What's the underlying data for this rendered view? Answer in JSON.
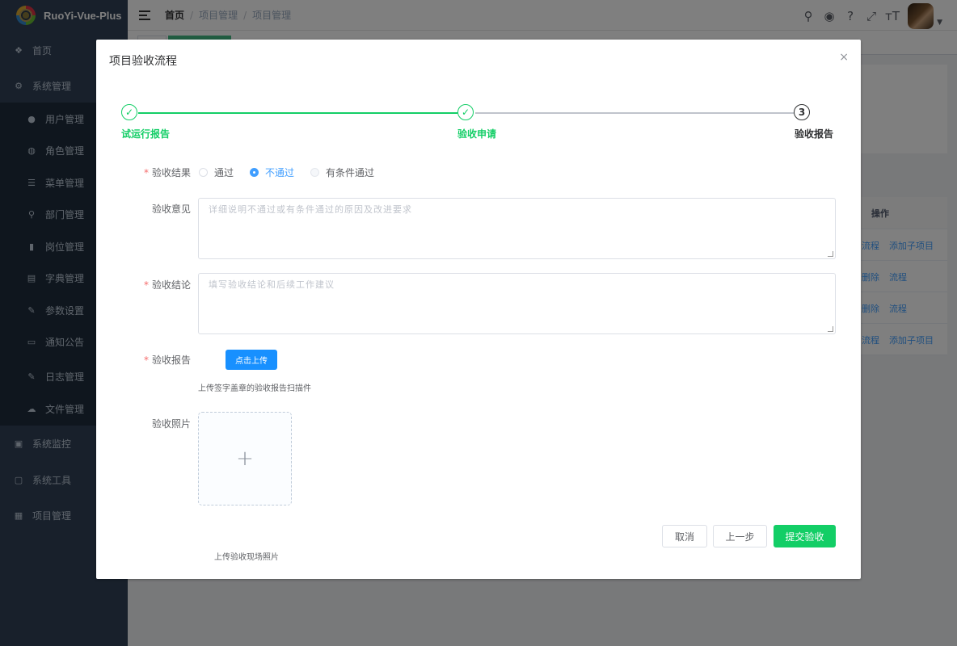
{
  "app": {
    "name": "RuoYi-Vue-Plus"
  },
  "sidebar": {
    "top_items": [
      {
        "label": "首页",
        "icon": "dashboard-icon"
      },
      {
        "label": "系统管理",
        "icon": "gear-icon"
      }
    ],
    "sub_items": [
      {
        "label": "用户管理",
        "icon": "user-icon"
      },
      {
        "label": "角色管理",
        "icon": "peoples-icon"
      },
      {
        "label": "菜单管理",
        "icon": "tree-table-icon"
      },
      {
        "label": "部门管理",
        "icon": "tree-icon"
      },
      {
        "label": "岗位管理",
        "icon": "post-icon"
      },
      {
        "label": "字典管理",
        "icon": "dict-icon"
      },
      {
        "label": "参数设置",
        "icon": "edit-icon"
      },
      {
        "label": "通知公告",
        "icon": "message-icon"
      },
      {
        "label": "日志管理",
        "icon": "log-icon"
      },
      {
        "label": "文件管理",
        "icon": "upload-icon"
      }
    ],
    "bottom_items": [
      {
        "label": "系统监控",
        "icon": "monitor-icon"
      },
      {
        "label": "系统工具",
        "icon": "tool-icon"
      },
      {
        "label": "项目管理",
        "icon": "grid-icon"
      }
    ]
  },
  "navbar": {
    "breadcrumb": [
      "首页",
      "项目管理",
      "项目管理"
    ]
  },
  "table": {
    "ops_header": "操作",
    "rows": [
      {
        "ops": [
          "流程",
          "添加子项目"
        ]
      },
      {
        "ops": [
          "删除",
          "流程"
        ]
      },
      {
        "ops": [
          "删除",
          "流程"
        ]
      },
      {
        "ops": [
          "流程",
          "添加子项目"
        ]
      }
    ]
  },
  "dialog": {
    "title": "项目验收流程",
    "close": "×",
    "steps": [
      {
        "title": "试运行报告",
        "status": "done"
      },
      {
        "title": "验收申请",
        "status": "done"
      },
      {
        "title": "验收报告",
        "status": "current",
        "number": "3"
      }
    ],
    "form": {
      "result_label": "验收结果",
      "result_options": [
        "通过",
        "不通过",
        "有条件通过"
      ],
      "result_selected": "不通过",
      "opinion_label": "验收意见",
      "opinion_placeholder": "详细说明不通过或有条件通过的原因及改进要求",
      "conclusion_label": "验收结论",
      "conclusion_placeholder": "填写验收结论和后续工作建议",
      "report_label": "验收报告",
      "upload_button": "点击上传",
      "report_tip": "上传签字盖章的验收报告扫描件",
      "photo_label": "验收照片",
      "photo_plus": "+",
      "photo_tip": "上传验收现场照片"
    },
    "buttons": {
      "cancel": "取消",
      "prev": "上一步",
      "submit": "提交验收"
    }
  },
  "colors": {
    "success": "#13ce66",
    "primary": "#409eff",
    "sidebar": "#304156"
  }
}
